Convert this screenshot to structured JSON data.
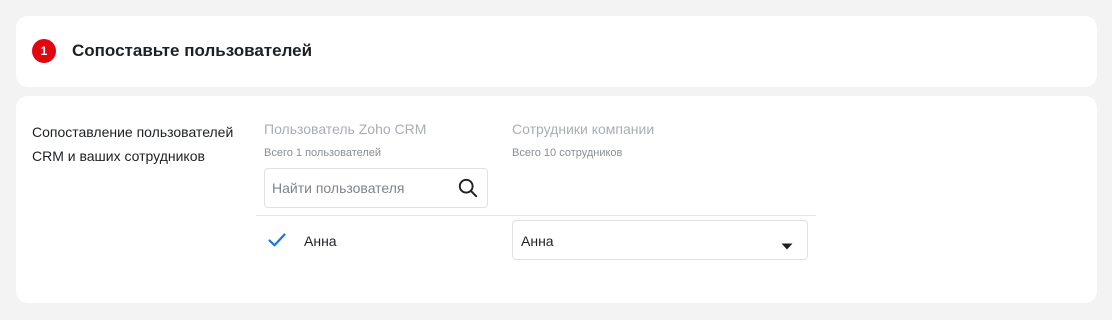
{
  "header": {
    "step_number": "1",
    "title": "Сопоставьте пользователей"
  },
  "section": {
    "label": "Сопоставление пользователей CRM и ваших сотрудников"
  },
  "columns": {
    "crm_users": {
      "title": "Пользователь Zoho CRM",
      "subtitle": "Всего 1 пользователей"
    },
    "employees": {
      "title": "Сотрудники компании",
      "subtitle": "Всего 10 сотрудников"
    }
  },
  "search": {
    "placeholder": "Найти пользователя",
    "value": ""
  },
  "mapping_rows": [
    {
      "crm_user": "Анна",
      "mapped_employee": "Анна",
      "checked": true
    }
  ],
  "icons": {
    "search": "search-icon",
    "check": "check-icon",
    "dropdown": "caret-down-icon"
  },
  "colors": {
    "accent": "#e30611",
    "check": "#1a73e8",
    "muted_title": "#a9aeb3",
    "background": "#f2f3f2"
  }
}
